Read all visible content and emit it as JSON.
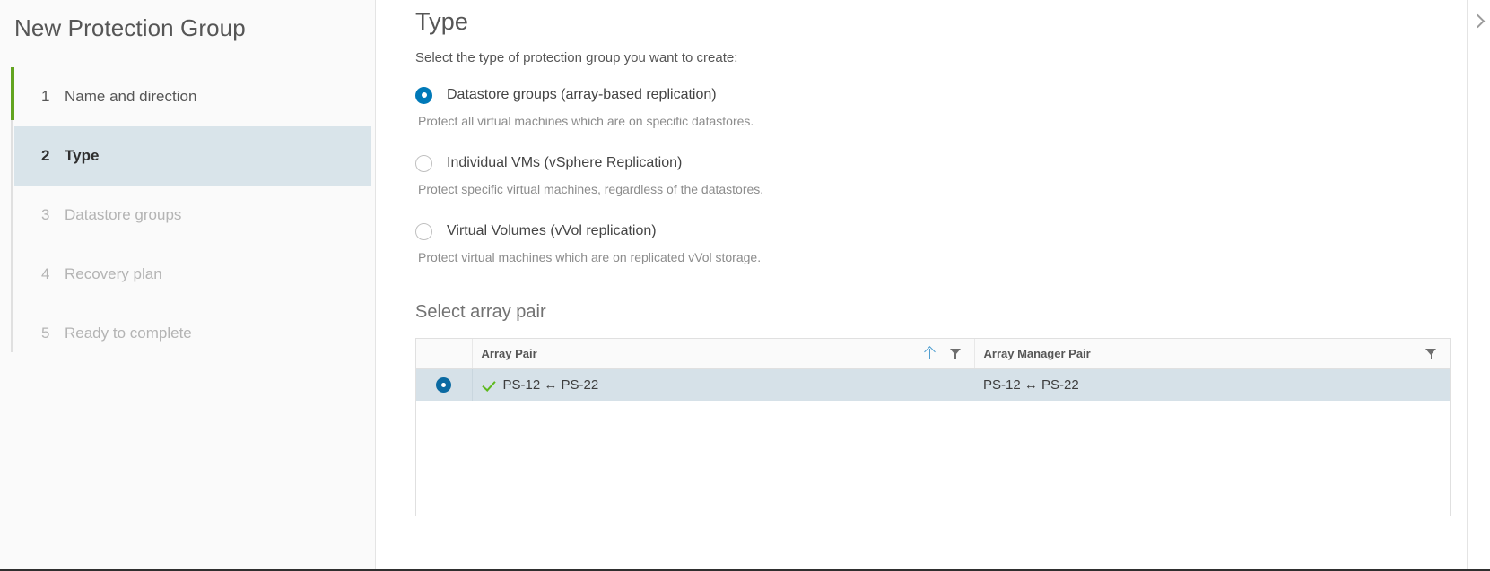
{
  "wizard": {
    "title": "New Protection Group",
    "steps": [
      {
        "num": "1",
        "label": "Name and direction",
        "state": "done"
      },
      {
        "num": "2",
        "label": "Type",
        "state": "current"
      },
      {
        "num": "3",
        "label": "Datastore groups",
        "state": "disabled"
      },
      {
        "num": "4",
        "label": "Recovery plan",
        "state": "disabled"
      },
      {
        "num": "5",
        "label": "Ready to complete",
        "state": "disabled"
      }
    ]
  },
  "page": {
    "title": "Type",
    "subtitle": "Select the type of protection group you want to create:"
  },
  "options": [
    {
      "label": "Datastore groups (array-based replication)",
      "help": "Protect all virtual machines which are on specific datastores.",
      "selected": true
    },
    {
      "label": "Individual VMs (vSphere Replication)",
      "help": "Protect specific virtual machines, regardless of the datastores.",
      "selected": false
    },
    {
      "label": "Virtual Volumes (vVol replication)",
      "help": "Protect virtual machines which are on replicated vVol storage.",
      "selected": false
    }
  ],
  "array_pair_section": {
    "title": "Select array pair",
    "columns": {
      "array_pair": "Array Pair",
      "array_manager_pair": "Array Manager Pair"
    },
    "rows": [
      {
        "array_pair": "PS-12 ↔ PS-22",
        "array_manager_pair": "PS-12 ↔ PS-22",
        "status": "ok",
        "selected": true
      }
    ]
  },
  "icons": {
    "sort_ascending": "sort-ascending-icon",
    "filter": "filter-funnel-icon",
    "status_ok": "green-check-icon",
    "collapse": "chevron-right-icon"
  },
  "colors": {
    "accent_blue": "#0079b8",
    "step_active_green": "#62a420",
    "row_highlight": "#d6e1e8",
    "status_green": "#5eb91e"
  }
}
